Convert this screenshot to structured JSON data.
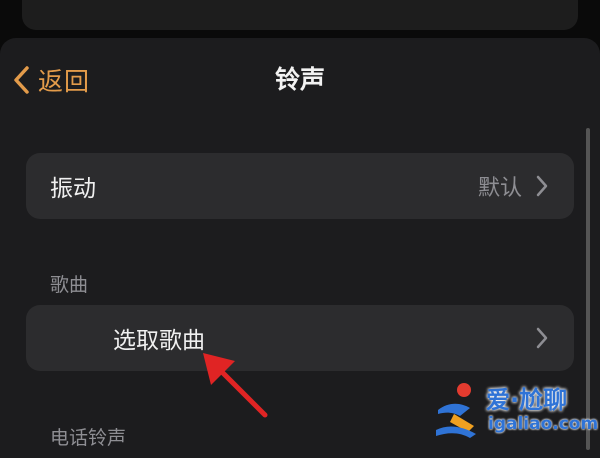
{
  "header": {
    "back_label": "返回",
    "title": "铃声"
  },
  "vibration_row": {
    "label": "振动",
    "value": "默认"
  },
  "sections": {
    "songs": "歌曲",
    "ringtone": "电话铃声"
  },
  "pick_song_row": {
    "label": "选取歌曲"
  },
  "watermark": {
    "title": "爱·尬聊",
    "url": "igaliao.com"
  },
  "colors": {
    "accent": "#e39b4a",
    "annotation_arrow": "#e02424",
    "watermark_blue": "#2f73d6"
  },
  "icons": {
    "back": "chevron-left-icon",
    "disclosure": "chevron-right-icon",
    "annotation": "red-arrow-icon"
  }
}
